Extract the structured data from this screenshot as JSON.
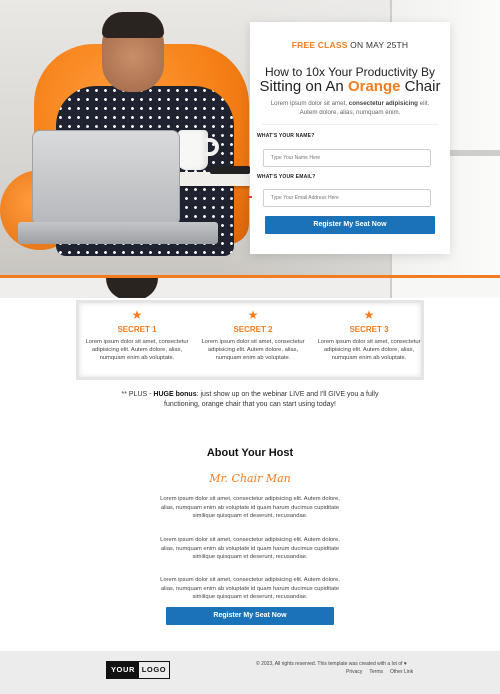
{
  "hero": {
    "image_subject": "man-sitting-on-orange-chair-with-laptop"
  },
  "form": {
    "kicker_accent": "FREE CLASS",
    "kicker_rest": "ON MAY 25TH",
    "title_line1": "How to 10x Your Productivity By",
    "title_line2_pre": "Sitting on An ",
    "title_line2_accent": "Orange",
    "title_line2_post": " Chair",
    "desc_part1": "Lorem ipsum dolor sit amet, ",
    "desc_bold": "consectetur adipisicing",
    "desc_part2": " elit. Autem dolore, alias, numquam enim.",
    "name_label": "WHAT'S YOUR NAME?",
    "name_placeholder": "Type Your Name Here",
    "email_label": "WHAT'S YOUR EMAIL?",
    "email_placeholder": "Type Your Email Address Here",
    "button": "Register My Seat Now"
  },
  "secrets": [
    {
      "icon": "star-icon",
      "title": "SECRET 1",
      "text": "Lorem ipsum dolor sit amet, consectetur adipisicing elit. Autem dolore, alias, numquam enim ab voluptate."
    },
    {
      "icon": "star-icon",
      "title": "SECRET 2",
      "text": "Lorem ipsum dolor sit amet, consectetur adipisicing elit. Autem dolore, alias, numquam enim ab voluptate."
    },
    {
      "icon": "star-icon",
      "title": "SECRET 3",
      "text": "Lorem ipsum dolor sit amet, consectetur adipisicing elit. Autem dolore, alias, numquam enim ab voluptate."
    }
  ],
  "plus_note": {
    "prefix": "** PLUS - ",
    "bold": "HUGE bonus",
    "rest": ": just show up on the webinar LIVE and I'll GIVE you a fully functioning, orange chair that you can start using today!"
  },
  "about": {
    "title": "About Your Host",
    "host_name": "Mr. Chair Man",
    "paragraphs": [
      "Lorem ipsum dolor sit amet, consectetur adipisicing elit. Autem dolore, alias, numquam enim ab voluptate id quam harum ducimus cupiditate similique quisquam et deserunt, recusandae.",
      "Lorem ipsum dolor sit amet, consectetur adipisicing elit. Autem dolore, alias, numquam enim ab voluptate id quam harum ducimus cupiditate similique quisquam et deserunt, recusandae.",
      "Lorem ipsum dolor sit amet, consectetur adipisicing elit. Autem dolore, alias, numquam enim ab voluptate id quam harum ducimus cupiditate similique quisquam et deserunt, recusandae."
    ],
    "button": "Register My Seat Now"
  },
  "footer": {
    "logo_left": "YOUR",
    "logo_right": "LOGO",
    "copyright": "© 2023, All rights reserved. This template was created with a lot of ♥",
    "links": [
      "Privacy",
      "Terms",
      "Other Link"
    ]
  },
  "colors": {
    "accent": "#f47c20",
    "button": "#1a73b8",
    "footer_bg": "#ececec"
  }
}
